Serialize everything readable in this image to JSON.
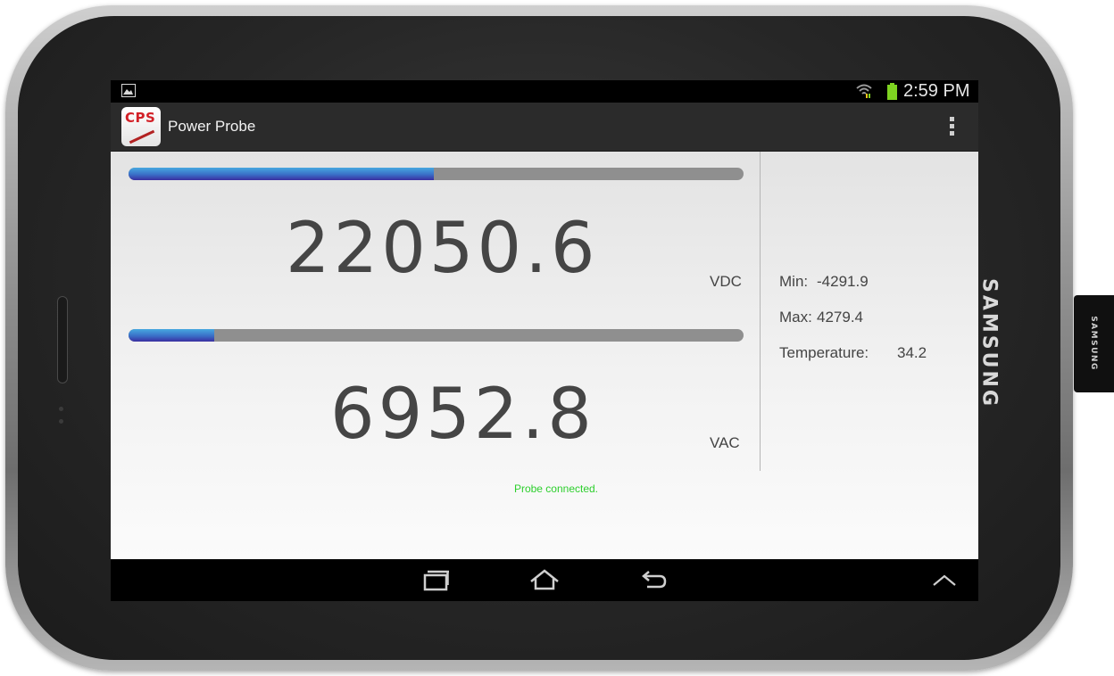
{
  "device": {
    "brand": "SAMSUNG",
    "side_brand": "SAMSUNG"
  },
  "status_bar": {
    "time": "2:59 PM",
    "battery_color": "#7ed321"
  },
  "app": {
    "title": "Power Probe",
    "icon_text": "CPS"
  },
  "readings": {
    "dc": {
      "value": "22050.6",
      "unit": "VDC",
      "bar_fill": 0.496
    },
    "ac": {
      "value": "6952.8",
      "unit": "VAC",
      "bar_fill": 0.14
    }
  },
  "stats": {
    "min_label": "Min:",
    "min_value": "-4291.9",
    "max_label": "Max:",
    "max_value": "4279.4",
    "temp_label": "Temperature:",
    "temp_value": "34.2"
  },
  "status_message": "Probe connected.",
  "colors": {
    "bar_fill": "#3a6fc7",
    "bar_track": "#8f8f8f",
    "status_ok": "#2dcf2d"
  },
  "nav": {
    "icons": [
      "recent-apps-icon",
      "home-icon",
      "back-icon",
      "expand-up-icon"
    ]
  }
}
